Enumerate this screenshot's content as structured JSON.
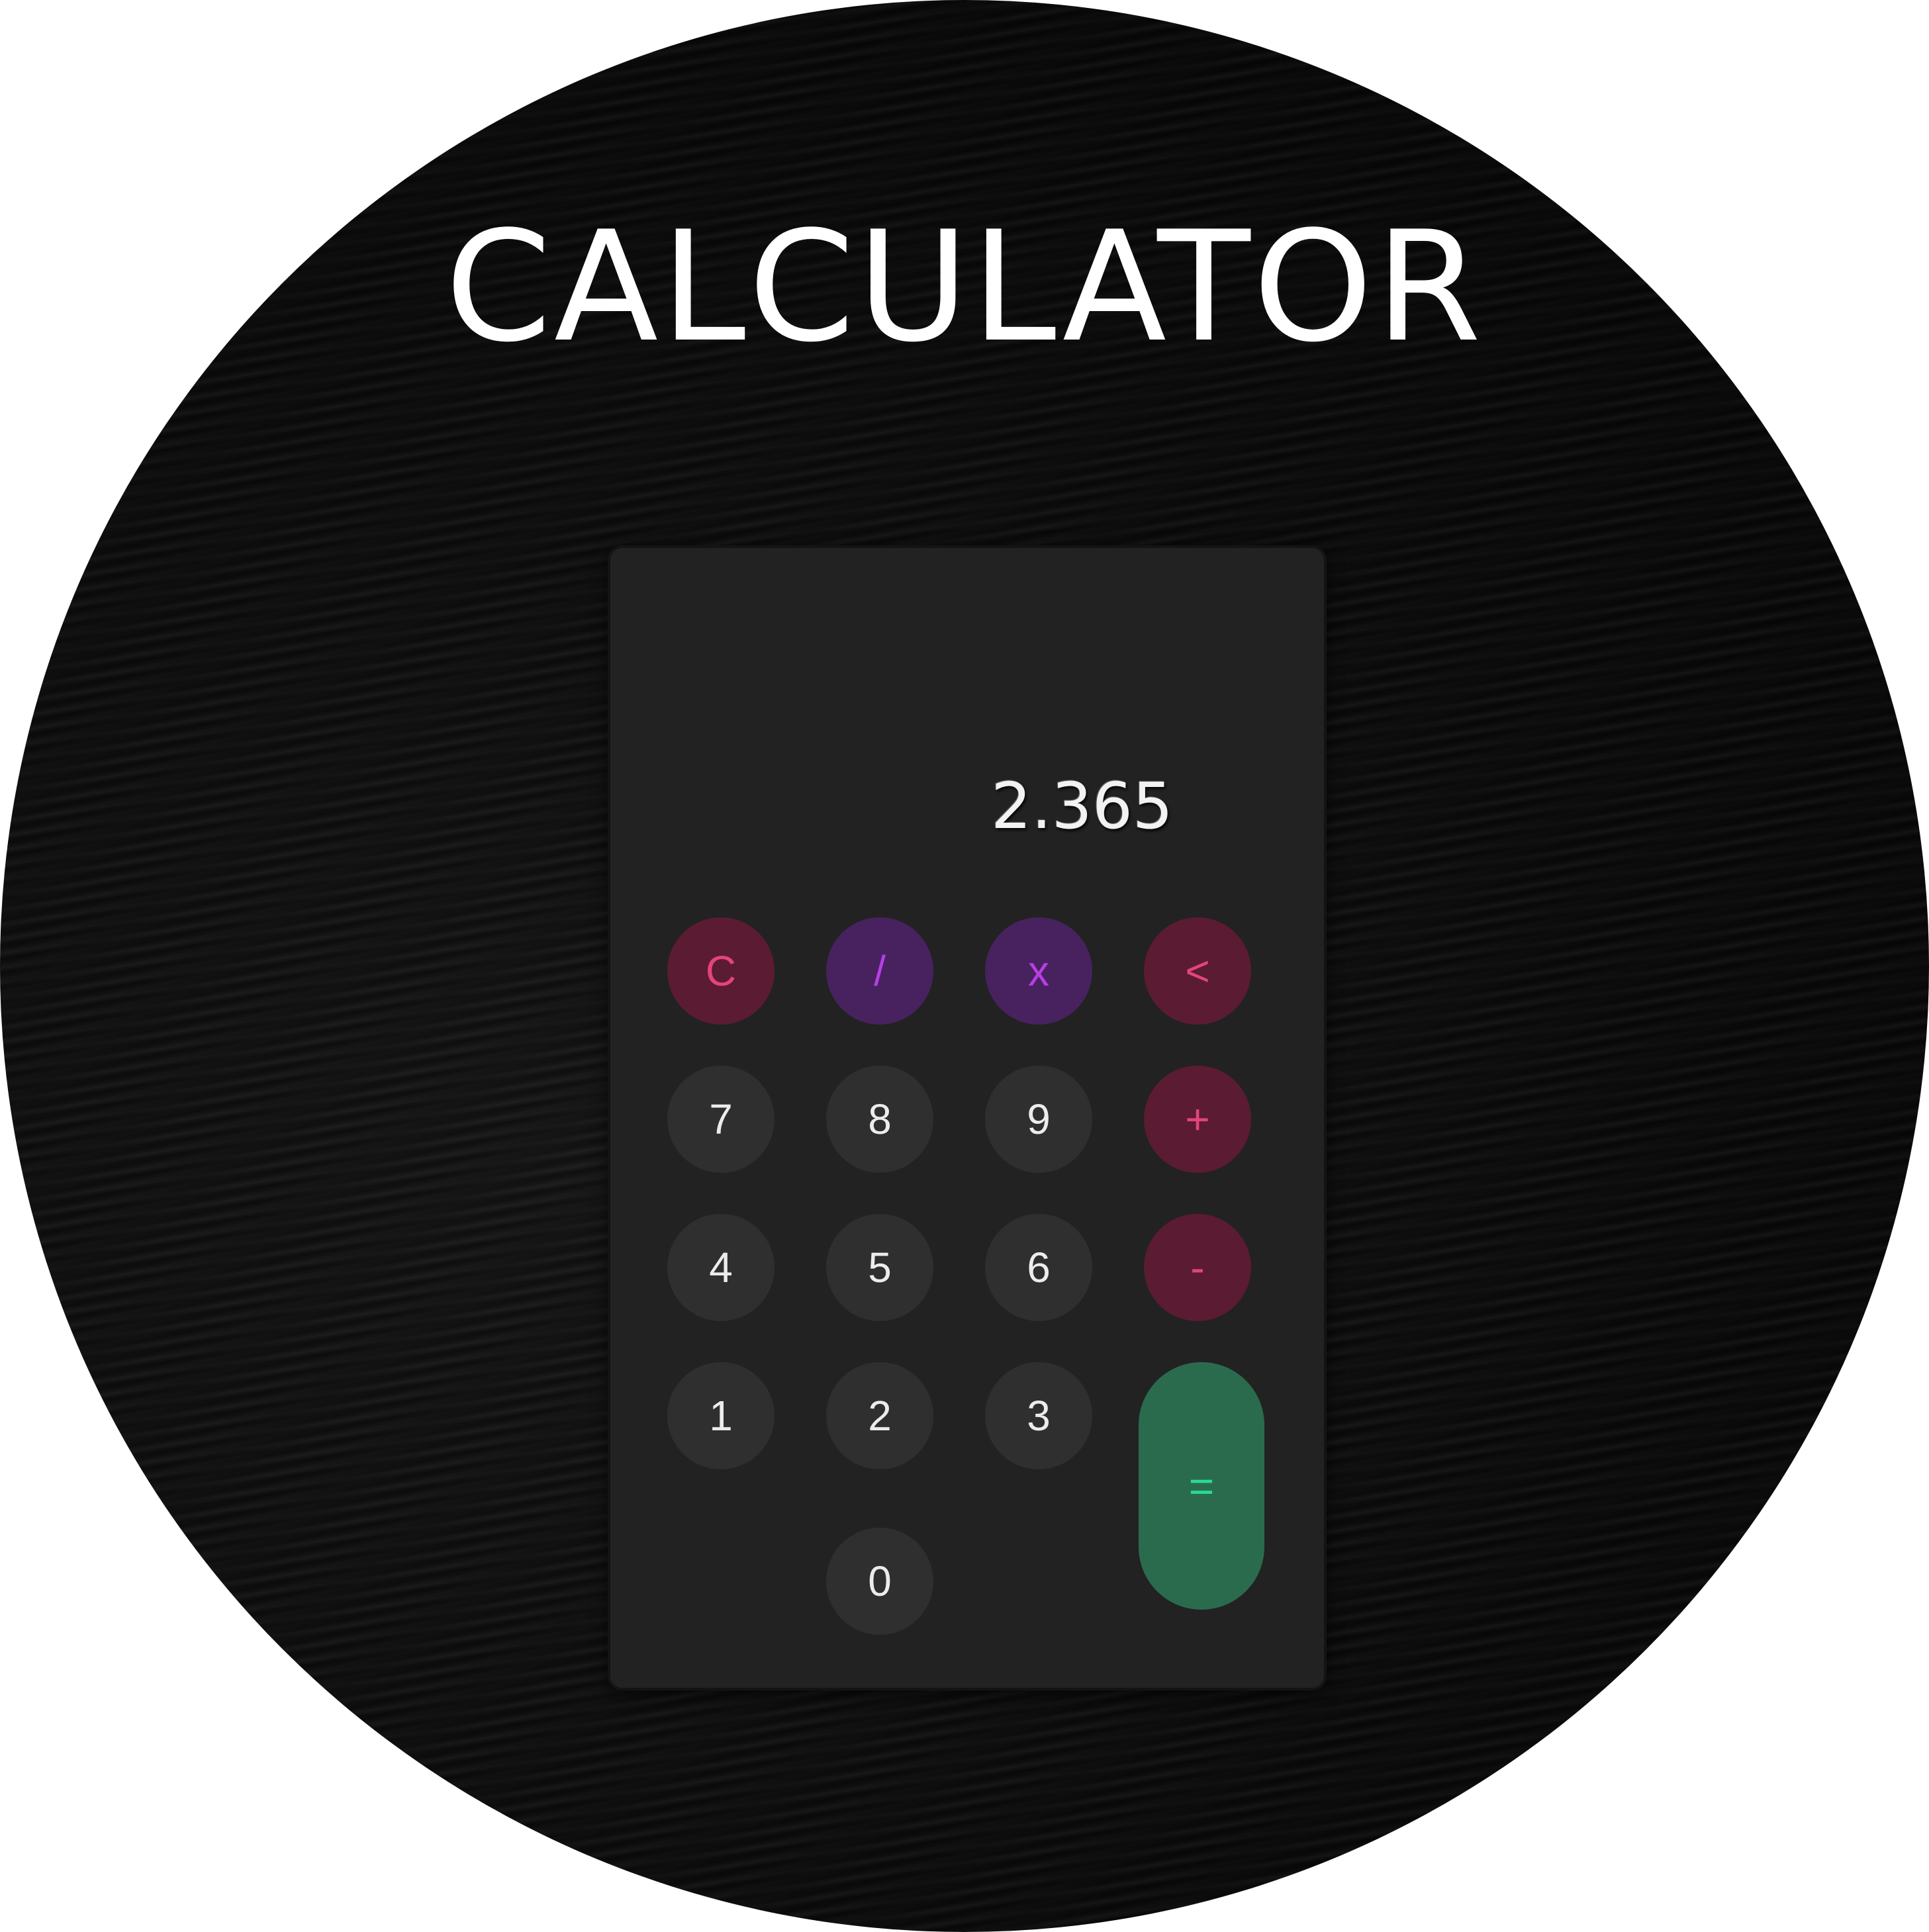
{
  "app": {
    "title": "CALCULATOR"
  },
  "display": {
    "value": "2.365"
  },
  "keys": {
    "clear": "C",
    "divide": "/",
    "multiply": "x",
    "backspace": "<",
    "seven": "7",
    "eight": "8",
    "nine": "9",
    "plus": "+",
    "four": "4",
    "five": "5",
    "six": "6",
    "minus": "-",
    "one": "1",
    "two": "2",
    "three": "3",
    "equals": "=",
    "zero": "0"
  },
  "colors": {
    "background": "#0a0a0a",
    "panel": "#222222",
    "digit_key": "#2f2f2f",
    "operator_red_bg": "#5b1b33",
    "operator_red_text": "#e3457a",
    "operator_purple_bg": "#47225f",
    "operator_purple_text": "#b93de6",
    "equals_bg": "#2a6b4e",
    "equals_text": "#29d99a"
  }
}
